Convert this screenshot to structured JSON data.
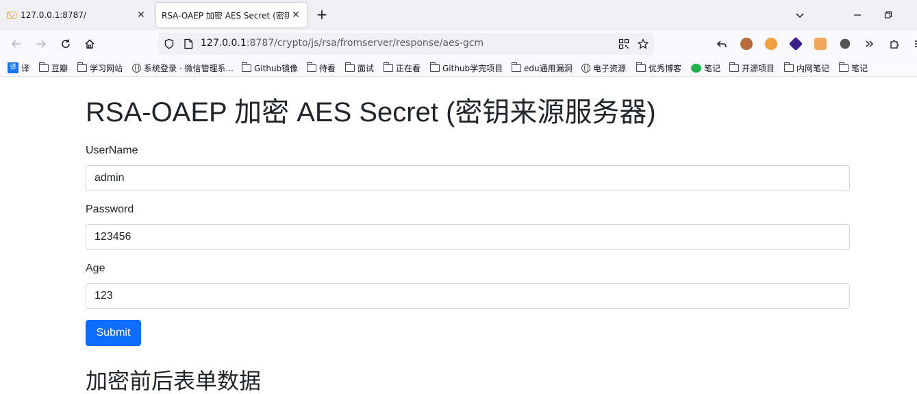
{
  "browser": {
    "tabs": [
      {
        "title": "127.0.0.1:8787/",
        "active": false,
        "icon": "mail-icon"
      },
      {
        "title": "RSA-OAEP 加密 AES Secret (密钥来源服务器)",
        "active": true
      }
    ],
    "url_host": "127.0.0.1",
    "url_rest": ":8787/crypto/js/rsa/fromserver/response/aes-gcm",
    "bookmarks": [
      {
        "label": "译",
        "icon": "translate-icon"
      },
      {
        "label": "豆瓣",
        "icon": "folder-icon"
      },
      {
        "label": "学习网站",
        "icon": "folder-icon"
      },
      {
        "label": "系统登录 · 微信管理系...",
        "icon": "globe-icon"
      },
      {
        "label": "Github镜像",
        "icon": "folder-icon"
      },
      {
        "label": "待看",
        "icon": "folder-icon"
      },
      {
        "label": "面试",
        "icon": "folder-icon"
      },
      {
        "label": "正在看",
        "icon": "folder-icon"
      },
      {
        "label": "Github学完项目",
        "icon": "folder-icon"
      },
      {
        "label": "edu通用漏洞",
        "icon": "folder-icon"
      },
      {
        "label": "电子资源",
        "icon": "globe-icon"
      },
      {
        "label": "优秀博客",
        "icon": "folder-icon"
      },
      {
        "label": "笔记",
        "icon": "wechat-icon"
      },
      {
        "label": "开源项目",
        "icon": "folder-icon"
      },
      {
        "label": "内网笔记",
        "icon": "folder-icon"
      },
      {
        "label": "笔记",
        "icon": "folder-icon"
      }
    ]
  },
  "page": {
    "title": "RSA-OAEP 加密 AES Secret (密钥来源服务器)",
    "form": {
      "username_label": "UserName",
      "username_value": "admin",
      "password_label": "Password",
      "password_value": "123456",
      "age_label": "Age",
      "age_value": "123",
      "submit_label": "Submit"
    },
    "section_title": "加密前后表单数据"
  },
  "colors": {
    "primary_button": "#0d6efd",
    "tabbar_bg": "#f0f0f4",
    "toolbar_bg": "#f9f9fb"
  }
}
